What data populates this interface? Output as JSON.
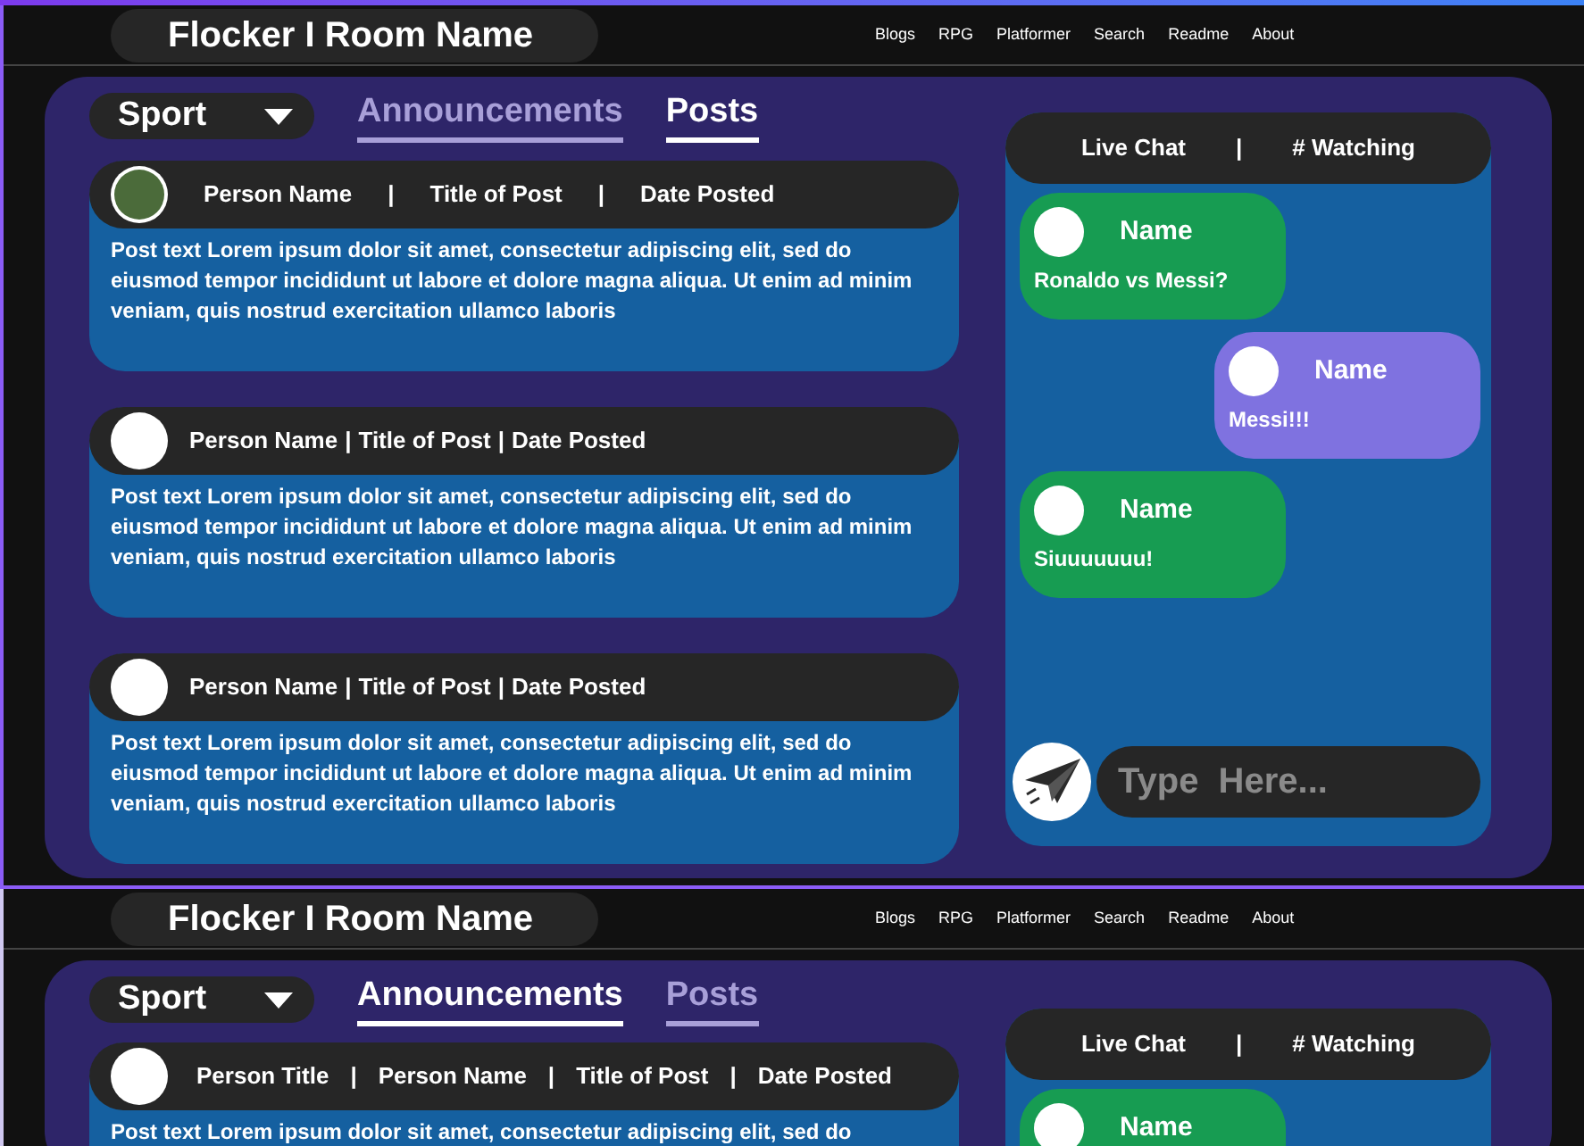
{
  "screens": [
    {
      "header": {
        "title": "Flocker I Room Name",
        "nav": [
          "Blogs",
          "RPG",
          "Platformer",
          "Search",
          "Readme",
          "About"
        ]
      },
      "dropdown": {
        "value": "Sport"
      },
      "tabs": [
        {
          "label": "Announcements",
          "selected": false
        },
        {
          "label": "Posts",
          "selected": true
        }
      ],
      "posts": [
        {
          "avatar": {
            "kind": "photo"
          },
          "kind": "spaced",
          "separator": "|",
          "meta": [
            "Person Name",
            "Title of Post",
            "Date Posted"
          ],
          "text": "Post text Lorem ipsum dolor sit amet, consectetur adipiscing elit, sed do eiusmod tempor incididunt ut labore et dolore magna aliqua. Ut enim ad minim veniam, quis nostrud exercitation ullamco laboris"
        },
        {
          "avatar": {
            "kind": "blank"
          },
          "kind": "compact",
          "separator": "|",
          "meta": [
            "Person Name",
            "Title of Post",
            "Date Posted"
          ],
          "text": "Post text  Lorem ipsum dolor sit amet, consectetur adipiscing elit, sed do eiusmod tempor incididunt ut labore et dolore magna aliqua. Ut enim ad minim veniam, quis nostrud exercitation ullamco laboris"
        },
        {
          "avatar": {
            "kind": "blank"
          },
          "kind": "compact",
          "separator": "|",
          "meta": [
            "Person Name",
            "Title of Post",
            "Date Posted"
          ],
          "text": "Post text  Lorem ipsum dolor sit amet, consectetur adipiscing elit, sed do eiusmod tempor incididunt ut labore et dolore magna aliqua. Ut enim ad minim veniam, quis nostrud exercitation ullamco laboris"
        }
      ],
      "chat": {
        "title": "Live Chat",
        "separator": "|",
        "watching": "# Watching",
        "messages": [
          {
            "kind": "incoming",
            "color": "#179c52",
            "name": "Name",
            "text": "Ronaldo vs Messi?"
          },
          {
            "kind": "outgoing",
            "color": "#7f72e0",
            "name": "Name",
            "text": "Messi!!!"
          },
          {
            "kind": "incoming",
            "color": "#179c52",
            "name": "Name",
            "text": "Siuuuuuuu!"
          }
        ],
        "input": {
          "placeholder": "Type  Here..."
        }
      }
    },
    {
      "header": {
        "title": "Flocker I Room Name",
        "nav": [
          "Blogs",
          "RPG",
          "Platformer",
          "Search",
          "Readme",
          "About"
        ]
      },
      "dropdown": {
        "value": "Sport"
      },
      "tabs": [
        {
          "label": "Announcements",
          "selected": true
        },
        {
          "label": "Posts",
          "selected": false
        }
      ],
      "posts": [
        {
          "avatar": {
            "kind": "blank"
          },
          "kind": "spaced",
          "separator": "|",
          "meta": [
            "Person Title",
            "Person Name",
            "Title of Post",
            "Date Posted"
          ],
          "text": "Post text Lorem ipsum dolor sit amet, consectetur adipiscing elit, sed do"
        }
      ],
      "chat": {
        "title": "Live Chat",
        "separator": "|",
        "watching": "# Watching",
        "messages": [
          {
            "kind": "incoming",
            "color": "#179c52",
            "name": "Name"
          }
        ]
      }
    }
  ]
}
